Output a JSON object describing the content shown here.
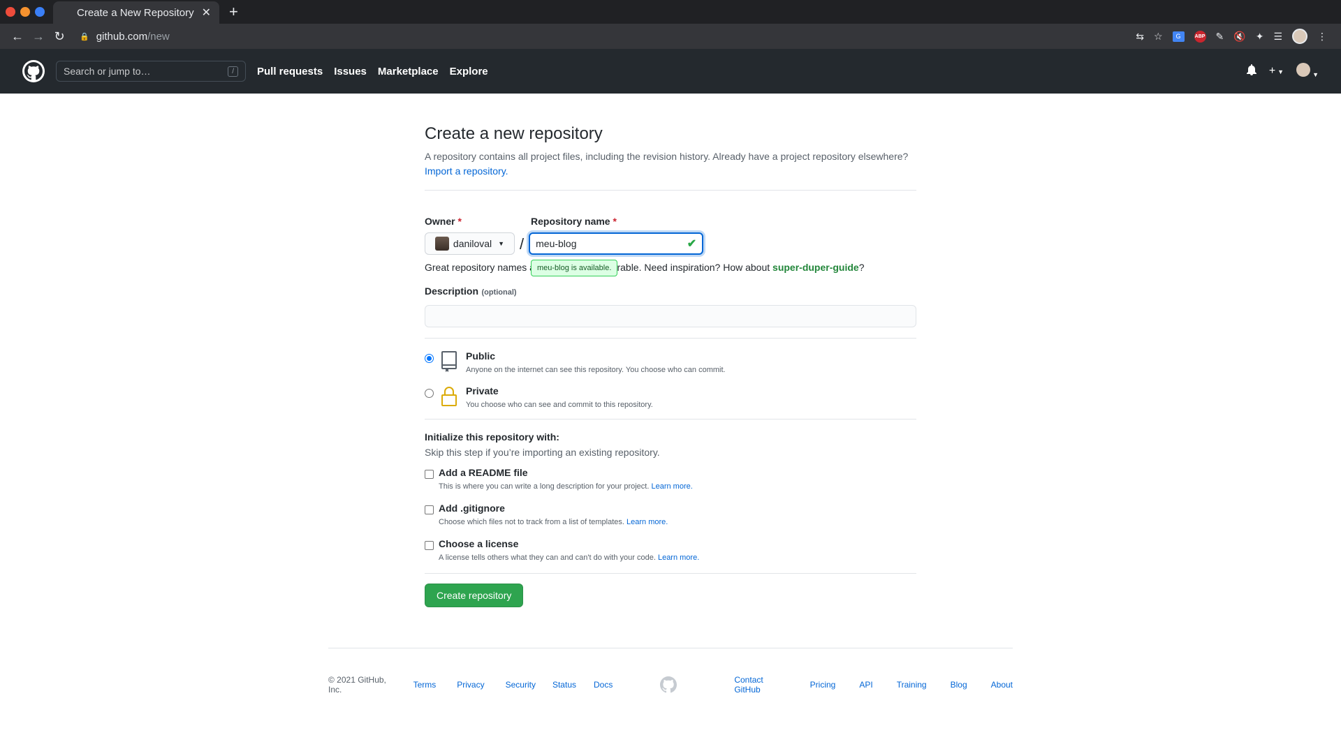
{
  "browser": {
    "tab_title": "Create a New Repository",
    "url_host": "github.com",
    "url_path": "/new",
    "abp_label": "ABP"
  },
  "header": {
    "search_placeholder": "Search or jump to…",
    "search_shortcut": "/",
    "nav": [
      "Pull requests",
      "Issues",
      "Marketplace",
      "Explore"
    ]
  },
  "page": {
    "title": "Create a new repository",
    "subtitle": "A repository contains all project files, including the revision history. Already have a project repository elsewhere?",
    "import_link": "Import a repository.",
    "owner_label": "Owner",
    "owner_value": "daniloval",
    "repo_label": "Repository name",
    "repo_value": "meu-blog",
    "availability_tooltip": "meu-blog is available.",
    "hint_prefix": "Great repository names are short and memorable. Need inspiration? How about ",
    "hint_suggestion": "super-duper-guide",
    "hint_suffix": "?",
    "description_label": "Description",
    "description_optional": "(optional)",
    "visibility": [
      {
        "title": "Public",
        "desc": "Anyone on the internet can see this repository. You choose who can commit.",
        "selected": true
      },
      {
        "title": "Private",
        "desc": "You choose who can see and commit to this repository.",
        "selected": false
      }
    ],
    "init_title": "Initialize this repository with:",
    "init_sub": "Skip this step if you’re importing an existing repository.",
    "init_options": [
      {
        "title": "Add a README file",
        "desc": "This is where you can write a long description for your project.",
        "link": "Learn more."
      },
      {
        "title": "Add .gitignore",
        "desc": "Choose which files not to track from a list of templates.",
        "link": "Learn more."
      },
      {
        "title": "Choose a license",
        "desc": "A license tells others what they can and can't do with your code.",
        "link": "Learn more."
      }
    ],
    "create_button": "Create repository"
  },
  "footer": {
    "copyright": "© 2021 GitHub, Inc.",
    "left_links": [
      "Terms",
      "Privacy",
      "Security",
      "Status",
      "Docs"
    ],
    "right_links": [
      "Contact GitHub",
      "Pricing",
      "API",
      "Training",
      "Blog",
      "About"
    ]
  },
  "colors": {
    "accent": "#0366d6",
    "primary_button": "#2ea44f",
    "header_bg": "#24292e",
    "success": "#28a745"
  }
}
